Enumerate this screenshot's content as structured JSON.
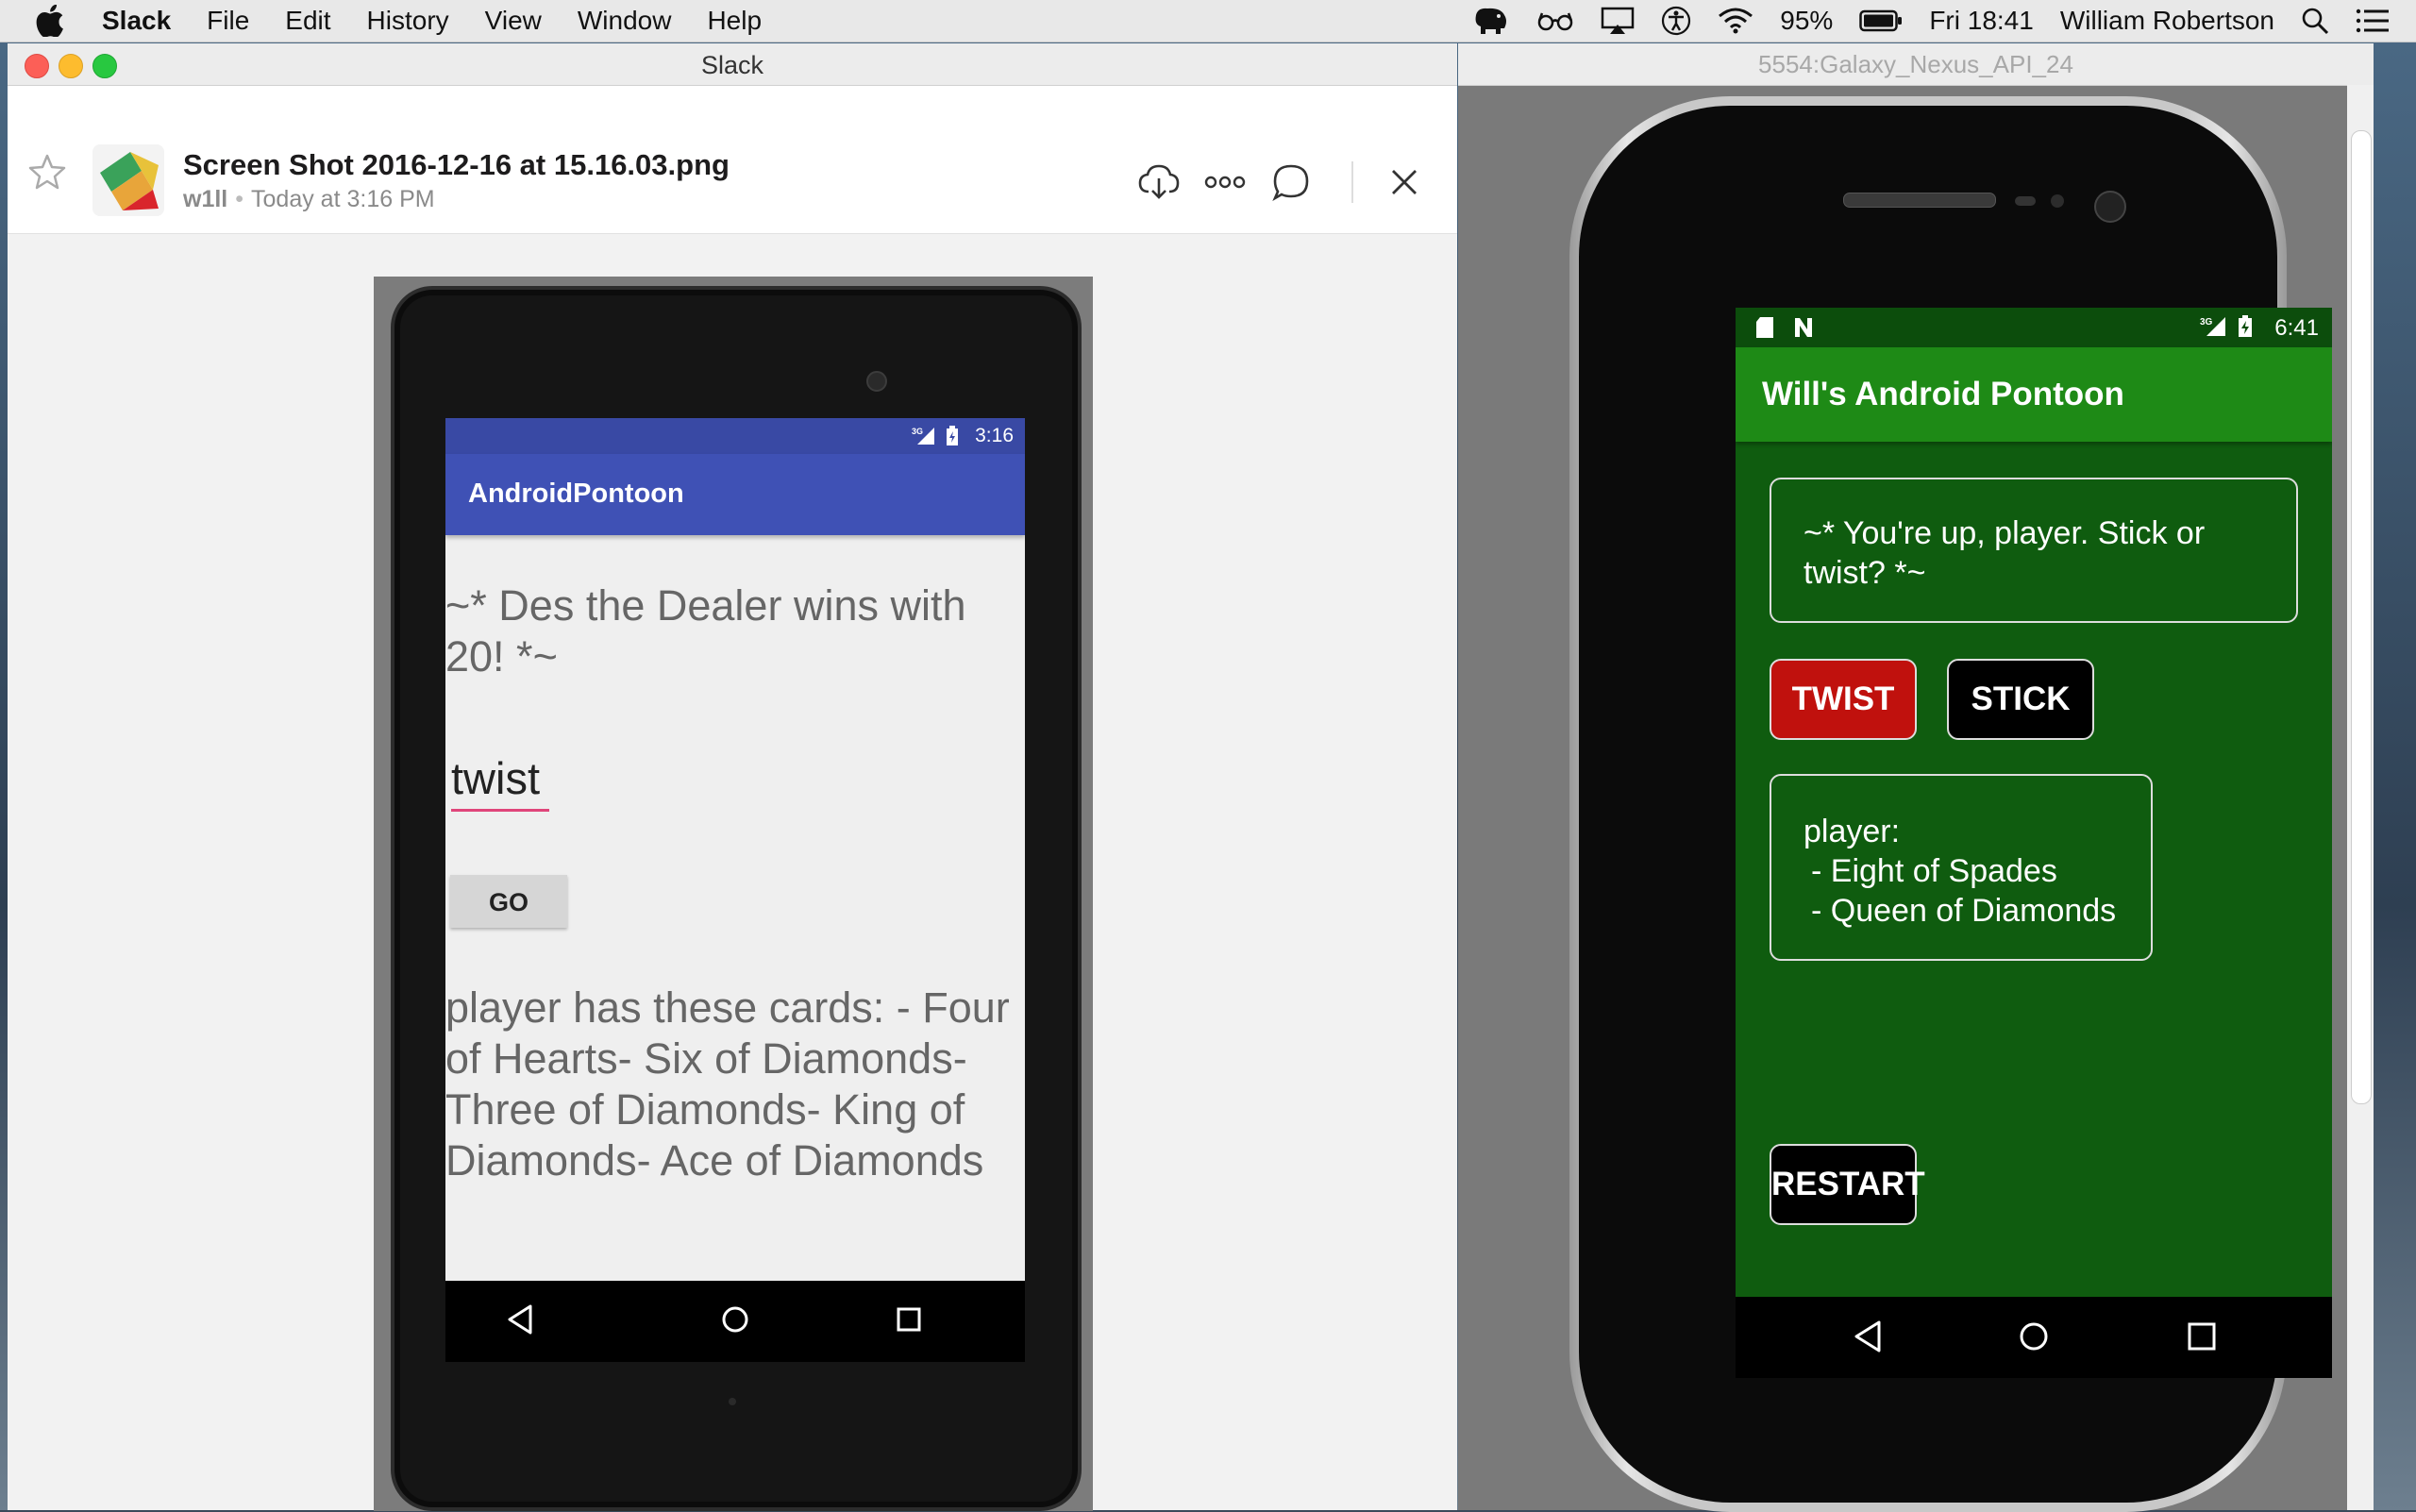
{
  "menubar": {
    "app": "Slack",
    "menus": [
      "File",
      "Edit",
      "History",
      "View",
      "Window",
      "Help"
    ],
    "battery": "95%",
    "clock": "Fri 18:41",
    "user": "William Robertson"
  },
  "slack": {
    "window_title": "Slack",
    "file_name": "Screen Shot 2016-12-16 at 15.16.03.png",
    "uploader": "w1ll",
    "timestamp": "Today at 3:16 PM"
  },
  "screenshot": {
    "status_time": "3:16",
    "status_network": "3G",
    "app_title": "AndroidPontoon",
    "message": "~* Des the Dealer wins with 20! *~",
    "input_value": "twist",
    "go_label": "GO",
    "cards_text": "player has these cards: - Four of Hearts- Six of Diamonds- Three of Diamonds- King of Diamonds- Ace of Diamonds"
  },
  "emulator": {
    "window_title": "5554:Galaxy_Nexus_API_24",
    "status_time": "6:41",
    "status_network": "3G",
    "app_title": "Will's Android Pontoon",
    "message": "~* You're up, player. Stick or twist? *~",
    "twist_label": "TWIST",
    "stick_label": "STICK",
    "hand_player": "player:",
    "hand_cards": [
      "- Eight of Spades",
      "- Queen of Diamonds"
    ],
    "restart_label": "RESTART"
  },
  "colors": {
    "android_appbar_blue": "#3f51b5",
    "pontoon_green": "#0f5c0f",
    "pontoon_appbar": "#1e8a16",
    "twist_red": "#c0110d"
  }
}
